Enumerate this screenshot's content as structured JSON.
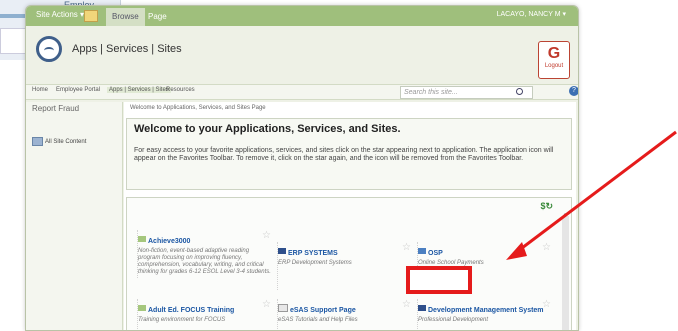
{
  "background": {
    "title": "Employ"
  },
  "ribbon": {
    "site_actions": "Site Actions ▾",
    "tab_browse": "Browse",
    "tab_page": "Page",
    "user": "LACAYO, NANCY M ▾"
  },
  "header": {
    "title": "Apps | Services | Sites",
    "logout_label": "Logout"
  },
  "topnav": {
    "items": [
      "Home",
      "Employee Portal",
      "Apps | Services | Sites",
      "Resources"
    ]
  },
  "search": {
    "placeholder": "Search this site..."
  },
  "leftnav": {
    "report": "Report Fraud",
    "all_site": "All Site Content"
  },
  "breadcrumb": "Welcome to Applications, Services, and Sites Page",
  "welcome": {
    "heading": "Welcome to your Applications, Services, and Sites.",
    "body": "For easy access to your favorite applications, services, and sites click on the star appearing next to application. The application icon will appear on the Favorites Toolbar.  To remove it, click on the star again, and the icon will be removed from the Favorites Toolbar."
  },
  "apps": [
    {
      "title": "Achieve3000",
      "desc": "Non-fiction, event-based adaptive reading program focusing on improving fluency, comprehension, vocabulary, writing, and critical thinking for grades 6-12 ESOL Level 3-4 students."
    },
    {
      "title": "ERP SYSTEMS",
      "desc": "ERP Development Systems"
    },
    {
      "title": "OSP",
      "desc": "Online School Payments"
    },
    {
      "title": "Adult Ed. FOCUS Training",
      "desc": "Training environment for FOCUS"
    },
    {
      "title": "eSAS Support Page",
      "desc": "eSAS Tutorials and Help Files"
    },
    {
      "title": "Development Management System",
      "desc": "Professional Development"
    }
  ],
  "colors": {
    "accent": "#9fbf7c",
    "link": "#1b56a3",
    "annotation": "#e51b1b"
  }
}
